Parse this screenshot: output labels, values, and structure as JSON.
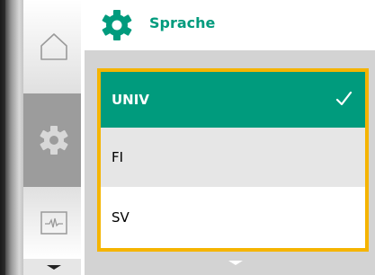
{
  "header": {
    "title": "Sprache",
    "icon": "gear-icon",
    "accent_color": "#009b7d"
  },
  "sidebar": {
    "items": [
      {
        "icon": "home-icon"
      },
      {
        "icon": "gear-icon",
        "active": true
      },
      {
        "icon": "pulse-monitor-icon"
      },
      {
        "icon": "chevron-down-icon"
      }
    ]
  },
  "language_list": {
    "selected_index": 0,
    "focus_color": "#f5b400",
    "items": [
      {
        "label": "UNIV",
        "selected": true
      },
      {
        "label": "FI"
      },
      {
        "label": "SV"
      }
    ],
    "more_below_icon": "chevron-down-icon"
  }
}
